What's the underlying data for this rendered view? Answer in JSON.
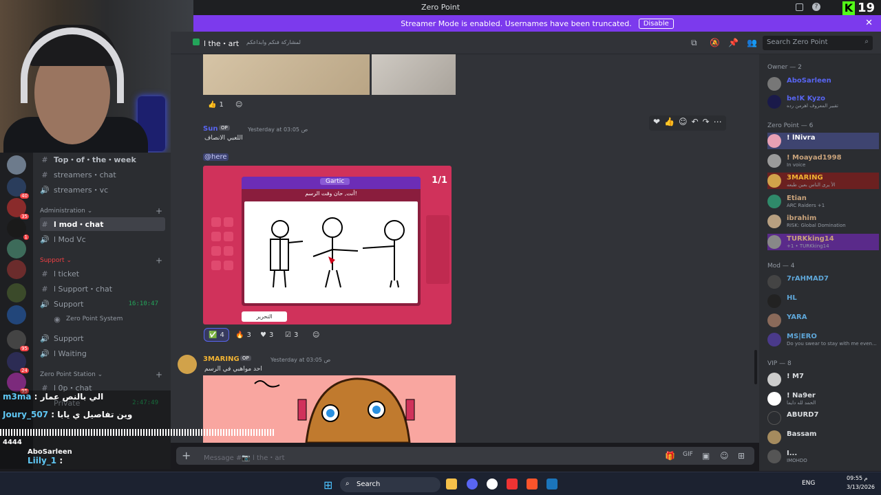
{
  "window": {
    "title": "Zero Point",
    "badge_k": "K",
    "badge_num": "19"
  },
  "banner": {
    "text": "Streamer Mode is enabled. Usernames have been truncated.",
    "button": "Disable"
  },
  "channel_header": {
    "name": "l the・art",
    "topic": "لمشاركة فنكم وابداعكم",
    "search_placeholder": "Search Zero Point"
  },
  "channels": {
    "top_week": "Top・of・the・week",
    "streamers_chat": "streamers・chat",
    "streamers_vc": "streamers・vc",
    "cat_admin": "Administration",
    "mod_chat": "l mod・chat",
    "mod_vc": "l Mod Vc",
    "cat_support": "Support",
    "ticket": "l ticket",
    "support_chat": "l Support・chat",
    "support_vc": "Support",
    "support_time": "16:10:47",
    "zero_system": "Zero Point System",
    "support2": "Support",
    "waiting": "l Waiting",
    "cat_station": "Zero Point Station",
    "op_chat": "l 0p・chat",
    "private": "Private",
    "private_time": "2:47:49"
  },
  "messages": {
    "m1_count": "1",
    "m2_user": "Sun",
    "m2_tag": "OP",
    "m2_time": "Yesterday at 03:05 ص",
    "m2_text": "اللعبي الانصاف",
    "m2_mention": "@here",
    "game_title": "Gartic",
    "game_question": "أنت, حان وقت الرسم!",
    "game_score": "1/1",
    "game_edit": "التحرير",
    "r_green": "4",
    "r_fire": "3",
    "r_red": "3",
    "r_check": "3",
    "m3_user": "3MARING",
    "m3_tag": "OP",
    "m3_time": "Yesterday at 03:05 ص",
    "m3_text": "احد مواهبي في الرسم"
  },
  "composer": {
    "placeholder": "Message #📷 l the・art"
  },
  "members": {
    "owner_header": "Owner — 2",
    "o1": "AboSarleen",
    "o2": "be!K Kyzo",
    "o2_status": "تقبير المعروف اهرمن رده",
    "zp_header": "Zero Point — 6",
    "z1": "! lNivra",
    "z2": "! Moayad1998",
    "z2_status": "In voice",
    "z3": "3MARING",
    "z3_status": "الأ يرى الناس بعين طبعه",
    "z4": "Etian",
    "z4_status": "ARC Raiders +1",
    "z5": "ibrahim",
    "z5_status": "RISK: Global Domination",
    "z6": "TURKking14",
    "z6_status": "+1 • TURKking14",
    "mod_header": "Mod — 4",
    "d1": "7rAHMAD7",
    "d2": "HL",
    "d3": "YARA",
    "d4": "MS|ERO",
    "d4_status": "Do you swear to stay with me even...",
    "vip_header": "VIP — 8",
    "v1": "! M7",
    "v2": "! Na9er",
    "v2_status": "الحمد لله دايما",
    "v3": "ABURD7",
    "v4": "Bassam",
    "v5": "I...",
    "v5_status": "IMOHDO"
  },
  "overlay": {
    "l1_user": "m3ma",
    "l1_text": ": الي بالنص عمار",
    "l2_user": "Joury_507",
    "l2_text": ": وين تفاصيل ي يابا",
    "l3_user": "AboSarleen",
    "l4_user": "Liily_1",
    "wave": "4444"
  },
  "taskbar": {
    "search": "Search",
    "lang": "ENG",
    "time": "09:55 م",
    "date": "3/13/2026"
  },
  "colors": {
    "banner": "#7c3aed",
    "accent": "#5865f2",
    "online": "#23a55a"
  }
}
